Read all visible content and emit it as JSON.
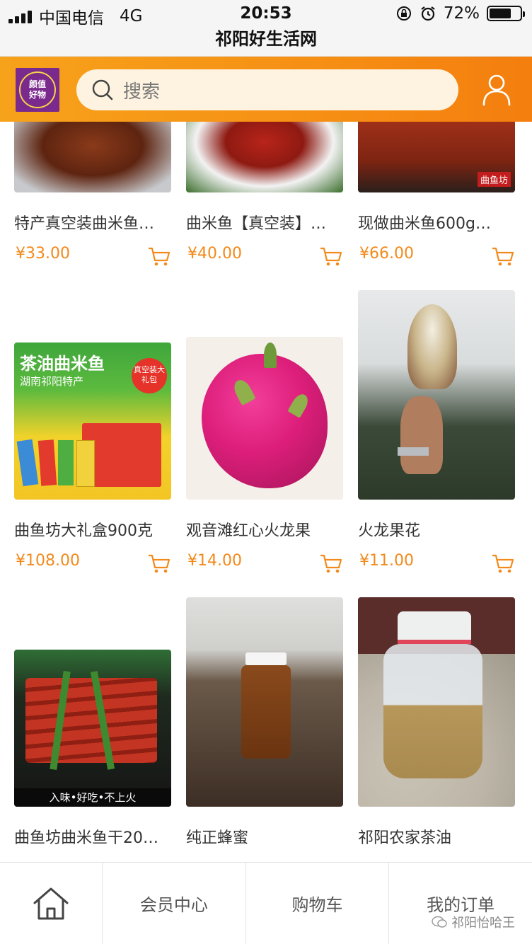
{
  "status_bar": {
    "carrier": "中国电信",
    "network": "4G",
    "time": "20:53",
    "battery": "72%",
    "battery_level": 0.72
  },
  "page_title": "祁阳好生活网",
  "header": {
    "logo_line1": "颜值",
    "logo_line2": "好物",
    "search_placeholder": "搜索"
  },
  "products": [
    {
      "name": "特产真空装曲米鱼…",
      "price": "¥33.00"
    },
    {
      "name": "曲米鱼【真空装】…",
      "price": "¥40.00"
    },
    {
      "name": "现做曲米鱼600g…",
      "price": "¥66.00",
      "img_text": "曲鱼坊"
    },
    {
      "name": "曲鱼坊大礼盒900克",
      "price": "¥108.00",
      "img_title": "茶油曲米鱼",
      "img_subtitle": "湖南祁阳特产",
      "img_badge": "真空装大礼包"
    },
    {
      "name": "观音滩红心火龙果",
      "price": "¥14.00"
    },
    {
      "name": "火龙果花",
      "price": "¥11.00"
    },
    {
      "name": "曲鱼坊曲米鱼干20…",
      "price": "",
      "img_caption": "入味•好吃•不上火"
    },
    {
      "name": "纯正蜂蜜",
      "price": ""
    },
    {
      "name": "祁阳农家茶油",
      "price": ""
    }
  ],
  "bottom_nav": {
    "member": "会员中心",
    "cart": "购物车",
    "orders": "我的订单"
  },
  "watermark": "祁阳怡哈王",
  "colors": {
    "accent": "#f68f14",
    "price": "#f28a1c"
  }
}
